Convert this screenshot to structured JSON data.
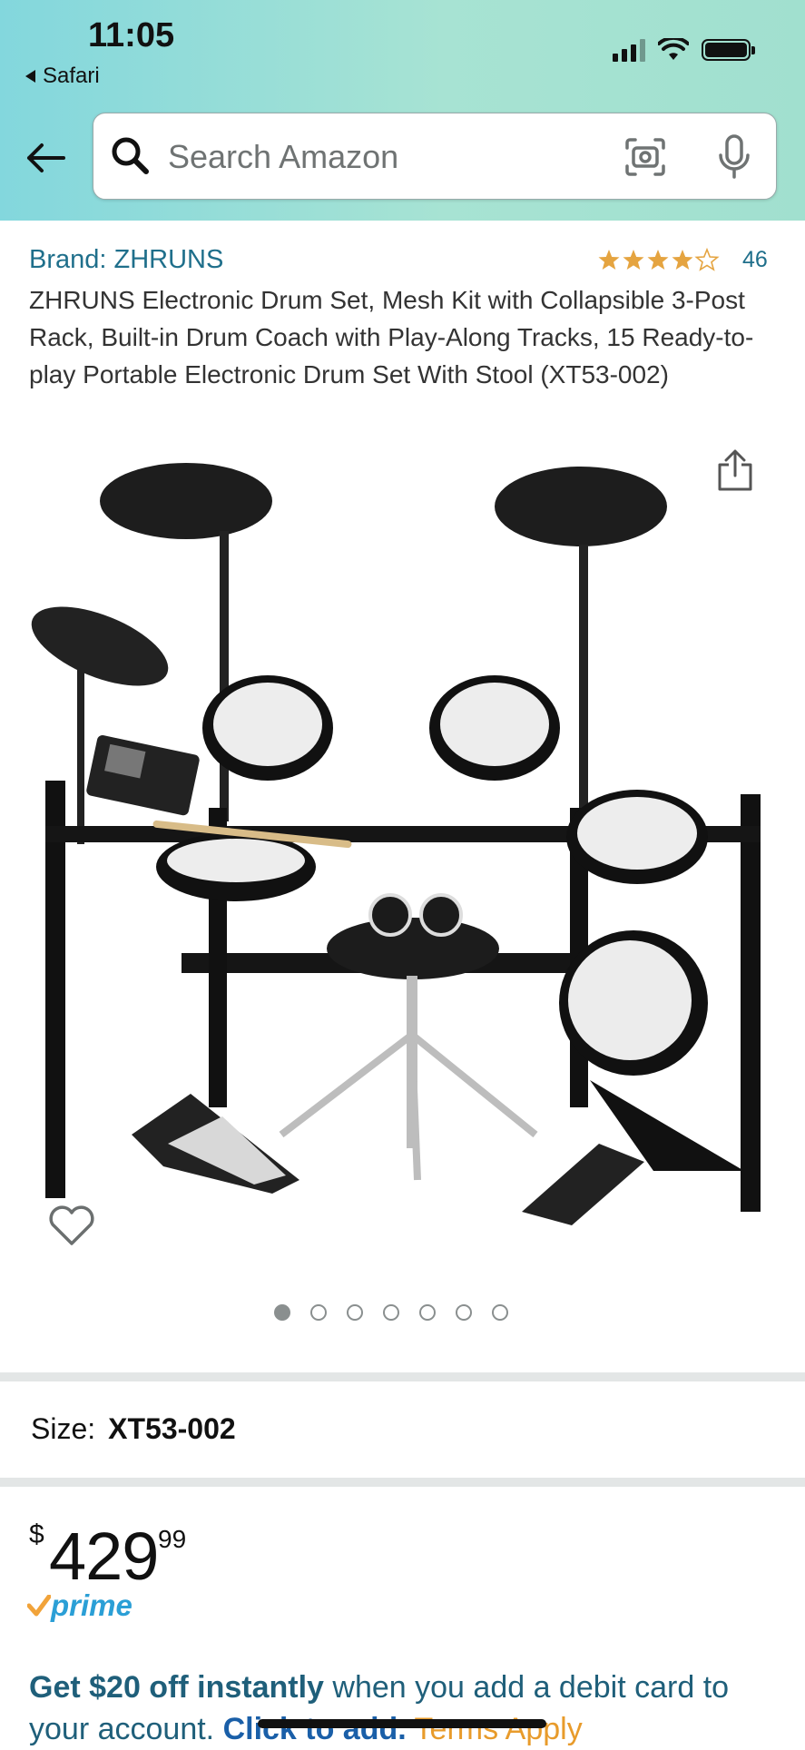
{
  "status_bar": {
    "time": "11:05",
    "back_app": "Safari"
  },
  "search": {
    "placeholder": "Search Amazon"
  },
  "product": {
    "brand": "Brand: ZHRUNS",
    "rating": 4.5,
    "rating_count": "46",
    "title": "ZHRUNS Electronic Drum Set, Mesh Kit with Collapsible 3-Post Rack, Built-in Drum Coach with Play-Along Tracks, 15 Ready-to-play Portable Electronic Drum Set With Stool (XT53-002)",
    "image_count": 7,
    "active_image": 1
  },
  "size": {
    "label": "Size:",
    "value": "XT53-002"
  },
  "price": {
    "currency": "$",
    "whole": "429",
    "fraction": "99"
  },
  "prime": {
    "label": "prime"
  },
  "deal": {
    "strong": "Get $20 off instantly",
    "text": " when you add a debit card to your account. ",
    "link": "Click to add.",
    "terms": " Terms Apply"
  },
  "colors": {
    "accent": "#1f6f8b",
    "star": "#e5a440",
    "prime": "#2b9fd6",
    "header": "#a7e3d3"
  }
}
